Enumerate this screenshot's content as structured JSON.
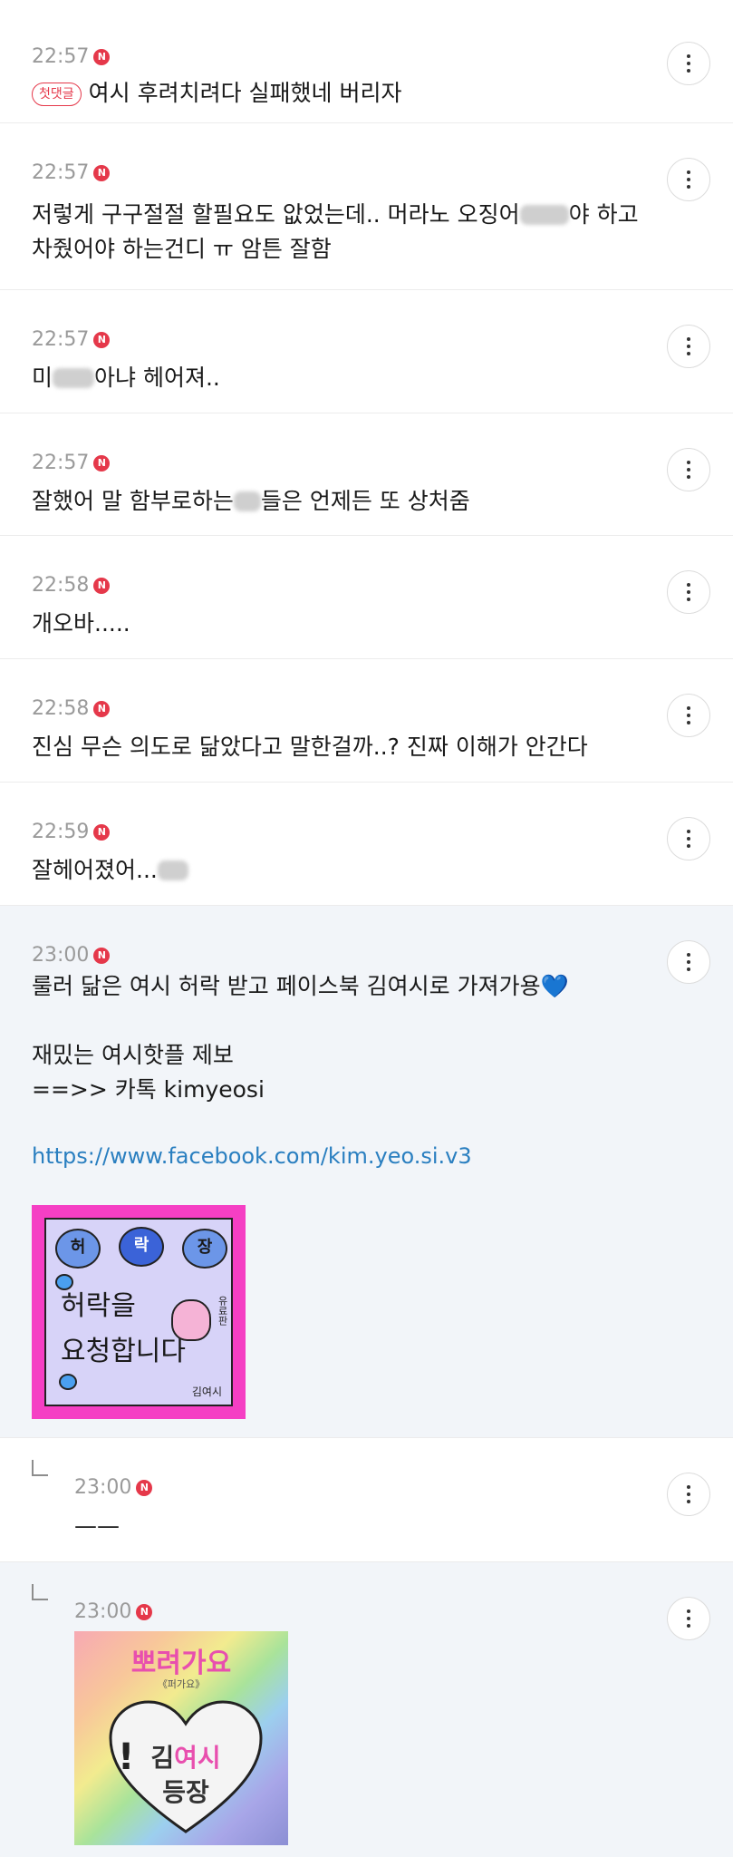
{
  "badge_letter": "N",
  "comments": [
    {
      "time": "22:57",
      "first_badge": "첫댓글",
      "text": "여시 후려치려다 실패했네 버리자"
    },
    {
      "time": "22:57",
      "line1_a": "저렇게 구구절절 할필요도 앖었는데.. 머라노 오징어",
      "line1_b": "야 하고",
      "line2": "차줬어야 하는건디 ㅠ 암튼 잘함"
    },
    {
      "time": "22:57",
      "text_a": "미",
      "text_b": "아냐 헤어져.."
    },
    {
      "time": "22:57",
      "text_a": "잘했어 말 함부로하는",
      "text_b": "들은 언제든 또 상처줌"
    },
    {
      "time": "22:58",
      "text": "개오바....."
    },
    {
      "time": "22:58",
      "text": "진심 무슨 의도로 닮았다고 말한걸까..? 진짜 이해가 안간다"
    },
    {
      "time": "22:59",
      "text": "잘헤어졌어..."
    },
    {
      "time": "23:00",
      "line1": "룰러 닮은 여시 허락 받고 페이스북 김여시로 가져가용",
      "line1_emoji": "💙",
      "line2": "재밌는 여시핫플 제보",
      "line3": "==>> 카톡 kimyeosi",
      "link": "https://www.facebook.com/kim.yeo.si.v3",
      "image": {
        "bubbles": [
          "허",
          "락",
          "장"
        ],
        "line1": "허락을",
        "line2": "요청합니다",
        "side": "유료판",
        "sign": "김여시"
      }
    },
    {
      "time": "23:00",
      "text": "——"
    },
    {
      "time": "23:00",
      "image": {
        "title": "뽀려가요",
        "sub": "《퍼가요》",
        "line1_a": "김",
        "line1_b": "여시",
        "line2": "등장"
      }
    }
  ]
}
